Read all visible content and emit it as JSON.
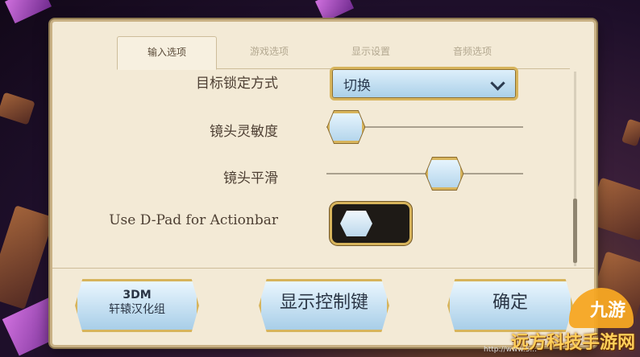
{
  "tabs": [
    "输入选项",
    "游戏选项",
    "显示设置",
    "音频选项"
  ],
  "settings": {
    "target_lock_label": "目标锁定方式",
    "target_lock_value": "切换",
    "camera_sensitivity_label": "镜头灵敏度",
    "camera_sensitivity_value": 0.1,
    "camera_smoothing_label": "镜头平滑",
    "camera_smoothing_value": 0.6,
    "dpad_label": "Use D-Pad for Actionbar",
    "dpad_enabled": false
  },
  "buttons": {
    "credit_line1": "3DM",
    "credit_line2": "轩辕汉化组",
    "show_controls": "显示控制键",
    "confirm": "确定"
  },
  "watermark": {
    "text": "远方科技手游网",
    "logo_text": "九游",
    "url": "http://www.5..."
  },
  "colors": {
    "panel": "#f3ead6",
    "gold_border": "#d7b45c",
    "button_blue": "#a8cee8"
  }
}
